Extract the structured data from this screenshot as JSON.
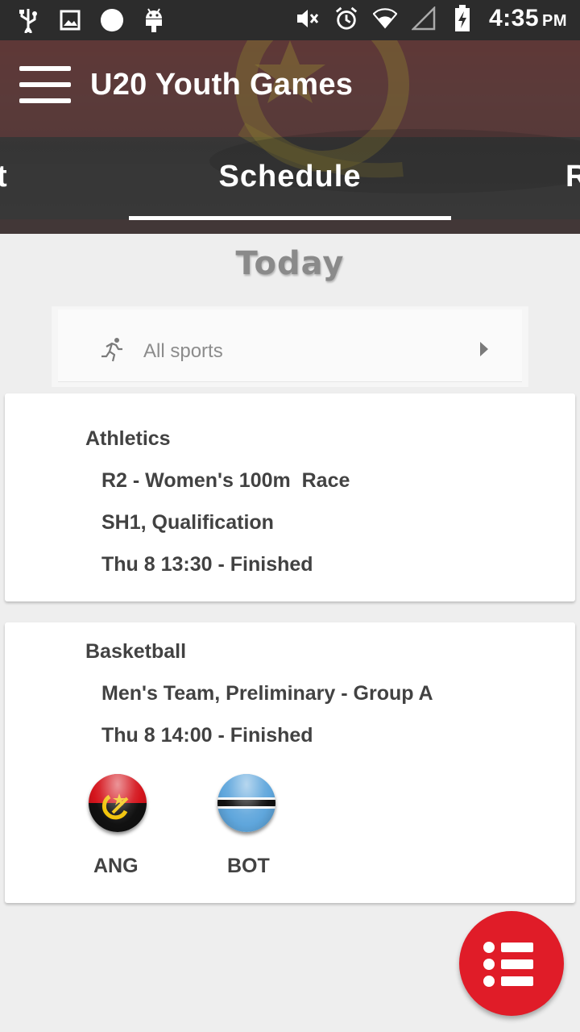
{
  "status_bar": {
    "time": "4:35",
    "ampm": "PM",
    "left_icons": [
      "usb-icon",
      "image-icon",
      "circle-icon",
      "android-icon"
    ],
    "right_icons": [
      "mute-icon",
      "alarm-icon",
      "wifi-icon",
      "signal-icon",
      "battery-charging-icon"
    ]
  },
  "app_bar": {
    "title": "U20 Youth Games",
    "menu_icon": "hamburger-menu-icon"
  },
  "tabs": [
    {
      "label": "t"
    },
    {
      "label": "Schedule",
      "active": true
    },
    {
      "label": "R"
    }
  ],
  "section_title": "Today",
  "filter": {
    "icon": "running-icon",
    "label": "All sports"
  },
  "events": [
    {
      "sport": "Athletics",
      "lines": [
        "R2 - Women's 100m  Race",
        "SH1, Qualification",
        "Thu 8 13:30 - Finished"
      ]
    },
    {
      "sport": "Basketball",
      "lines": [
        "Men's Team, Preliminary - Group A",
        "Thu 8 14:00 - Finished"
      ],
      "teams": [
        {
          "code": "ANG",
          "flag": "angola-flag-icon"
        },
        {
          "code": "BOT",
          "flag": "botswana-flag-icon"
        }
      ]
    }
  ],
  "fab": {
    "icon": "list-icon"
  },
  "colors": {
    "accent": "#e01c28",
    "status_bar": "#2c2c2c",
    "background": "#eeeeee"
  }
}
